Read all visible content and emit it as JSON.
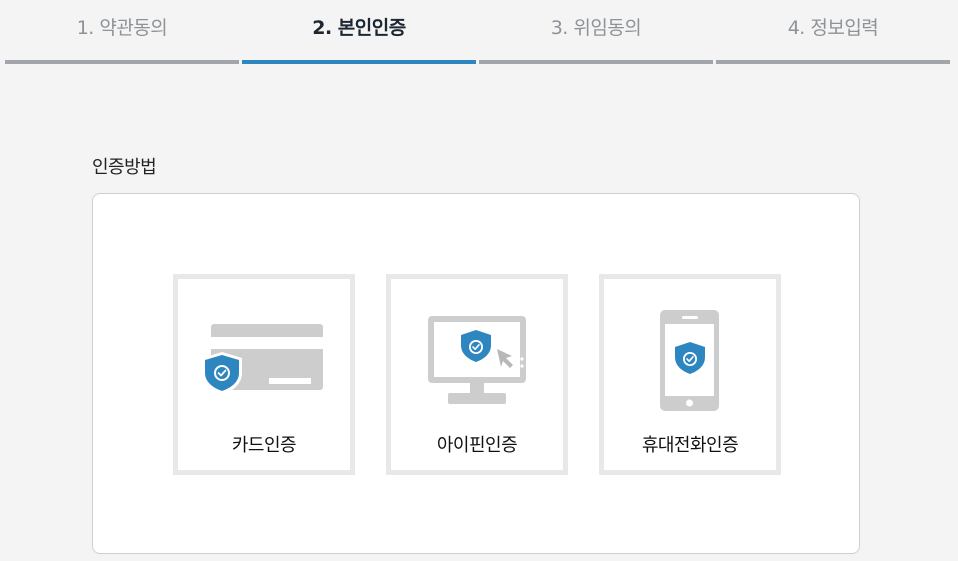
{
  "steps": [
    {
      "label": "1. 약관동의",
      "active": false
    },
    {
      "label": "2. 본인인증",
      "active": true
    },
    {
      "label": "3. 위임동의",
      "active": false
    },
    {
      "label": "4. 정보입력",
      "active": false
    }
  ],
  "colors": {
    "accent": "#2e86c1",
    "inactive_bar": "#a2a6aa",
    "icon_gray": "#cdcdcd",
    "shield_blue": "#2e86c1"
  },
  "section": {
    "title": "인증방법"
  },
  "methods": [
    {
      "label": "카드인증",
      "icon": "card-shield-icon"
    },
    {
      "label": "아이핀인증",
      "icon": "monitor-shield-icon"
    },
    {
      "label": "휴대전화인증",
      "icon": "phone-shield-icon"
    }
  ]
}
